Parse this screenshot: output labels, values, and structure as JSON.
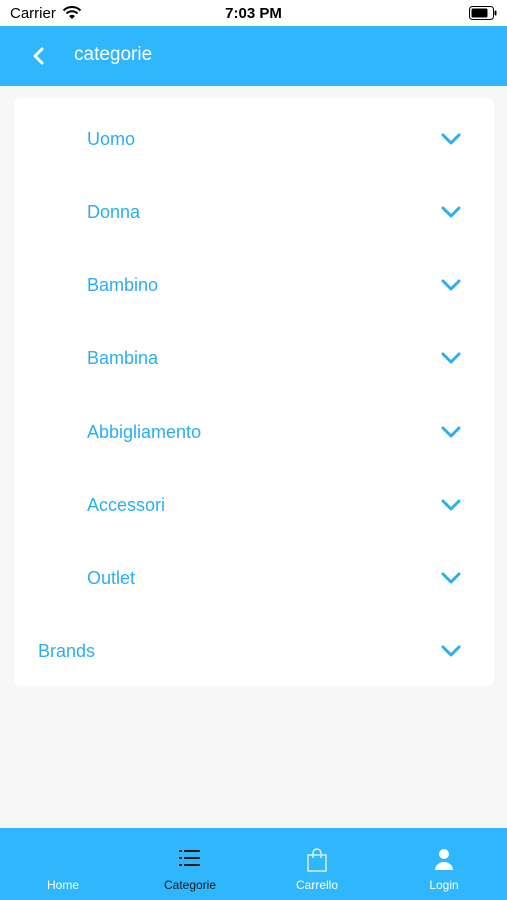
{
  "status_bar": {
    "carrier": "Carrier",
    "time": "7:03 PM"
  },
  "header": {
    "title": "categorie",
    "back_icon": "chevron-left-icon"
  },
  "categories": [
    {
      "label": "Uomo"
    },
    {
      "label": "Donna"
    },
    {
      "label": "Bambino"
    },
    {
      "label": "Bambina"
    },
    {
      "label": "Abbigliamento"
    },
    {
      "label": "Accessori"
    },
    {
      "label": "Outlet"
    }
  ],
  "brands": {
    "label": "Brands"
  },
  "tab_bar": {
    "tabs": [
      {
        "label": "Home",
        "icon": "home-icon"
      },
      {
        "label": "Categorie",
        "icon": "list-icon",
        "active": true
      },
      {
        "label": "Carrello",
        "icon": "shopping-bag-icon"
      },
      {
        "label": "Login",
        "icon": "user-icon"
      }
    ]
  },
  "colors": {
    "accent": "#2fb6fd",
    "label": "#2aaef0",
    "active_tab": "#1c1c1c"
  }
}
